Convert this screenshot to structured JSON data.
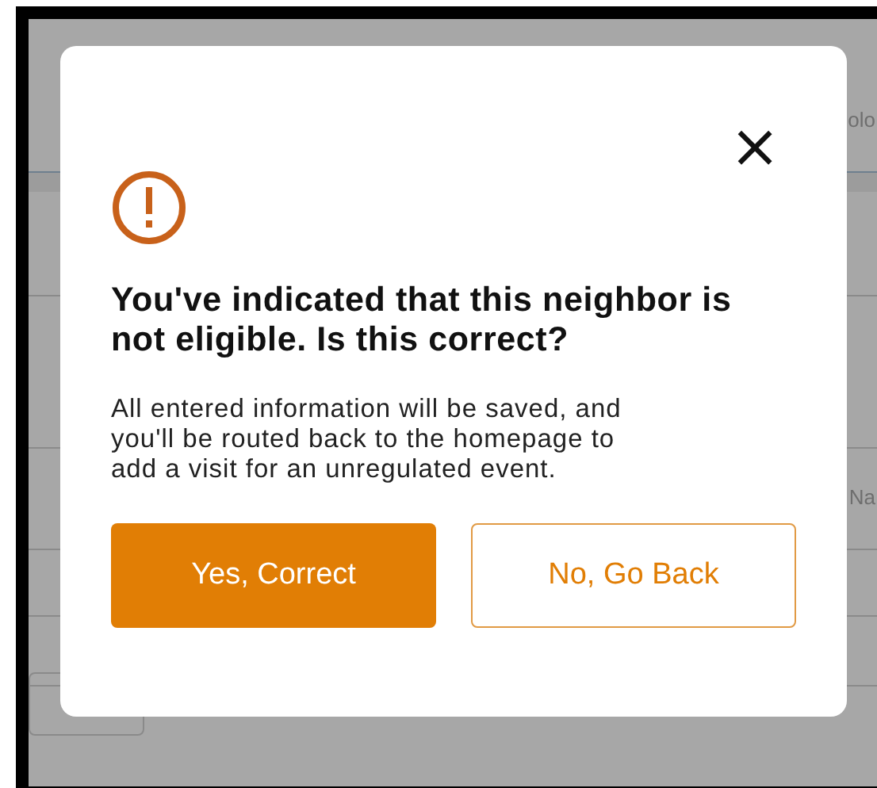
{
  "background": {
    "fragments": [
      "olo",
      "Na"
    ]
  },
  "dialog": {
    "close": "×",
    "title": "You've indicated that this neighbor is not eligible. Is this correct?",
    "message": "All entered information will be saved, and you'll be routed back to the homepage to add a visit for an unregulated event.",
    "buttons": [
      {
        "label": "Yes, Correct",
        "kind": "primary"
      },
      {
        "label": "No, Go Back",
        "kind": "secondary"
      }
    ]
  }
}
